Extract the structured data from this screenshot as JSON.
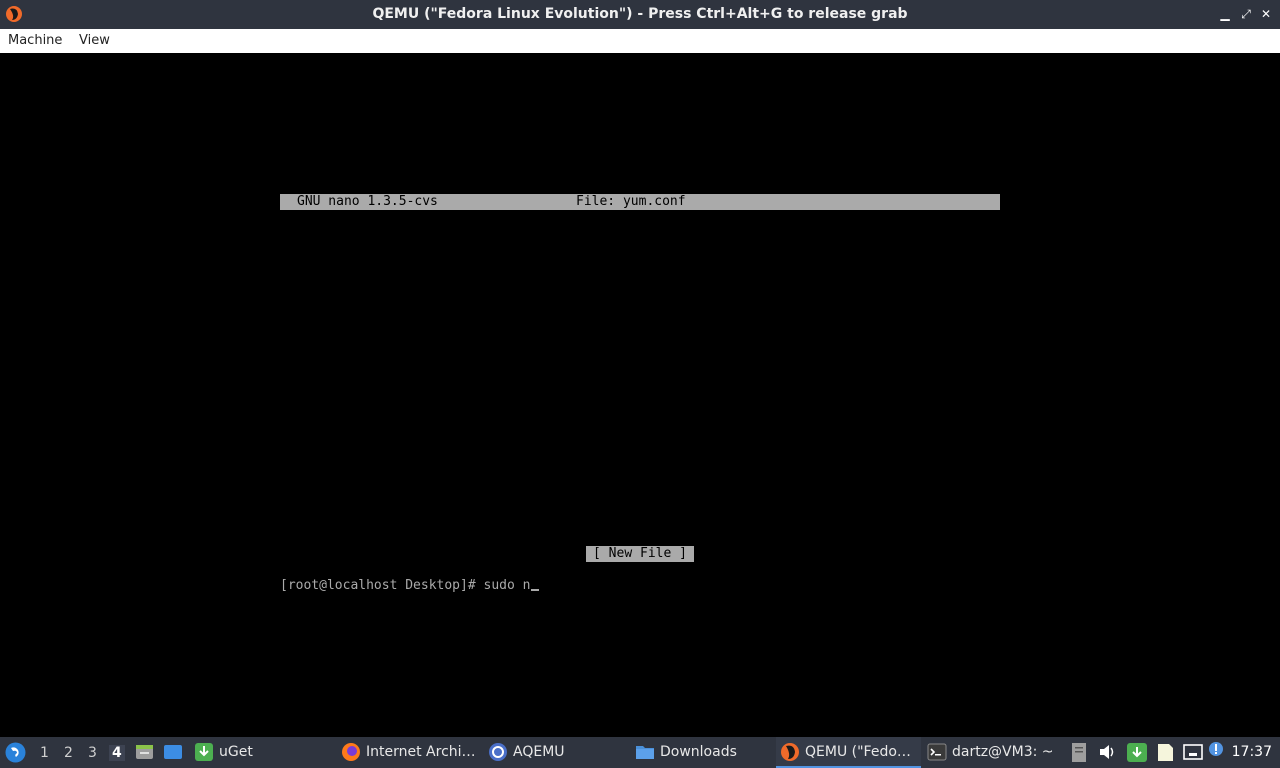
{
  "window": {
    "title": "QEMU (\"Fedora Linux Evolution\") - Press Ctrl+Alt+G to release grab",
    "minimize_glyph": "▁",
    "restore_glyph": "⤢",
    "close_glyph": "✕"
  },
  "menubar": {
    "items": [
      "Machine",
      "View"
    ]
  },
  "terminal": {
    "nano_version": "GNU nano 1.3.5-cvs",
    "nano_file": "File: yum.conf",
    "status": "[ New File ]",
    "prompt": "[root@localhost Desktop]# sudo n"
  },
  "taskbar": {
    "workspaces": [
      "1",
      "2",
      "3",
      "4"
    ],
    "active_workspace": "4",
    "tasks": [
      {
        "label": "uGet",
        "icon": "uget-icon"
      },
      {
        "label": "Internet Archi…",
        "icon": "firefox-icon"
      },
      {
        "label": "AQEMU",
        "icon": "aqemu-icon"
      },
      {
        "label": "Downloads",
        "icon": "folder-icon"
      },
      {
        "label": "QEMU (\"Fedo…",
        "icon": "qemu-icon"
      },
      {
        "label": "dartz@VM3: ~",
        "icon": "terminal-icon"
      }
    ],
    "clock": "17:37"
  },
  "colors": {
    "titlebar_bg": "#2f343f",
    "taskbar_bg": "#2f343f",
    "accent": "#5294e2",
    "terminal_bg": "#000000",
    "terminal_fg": "#aaaaaa"
  }
}
